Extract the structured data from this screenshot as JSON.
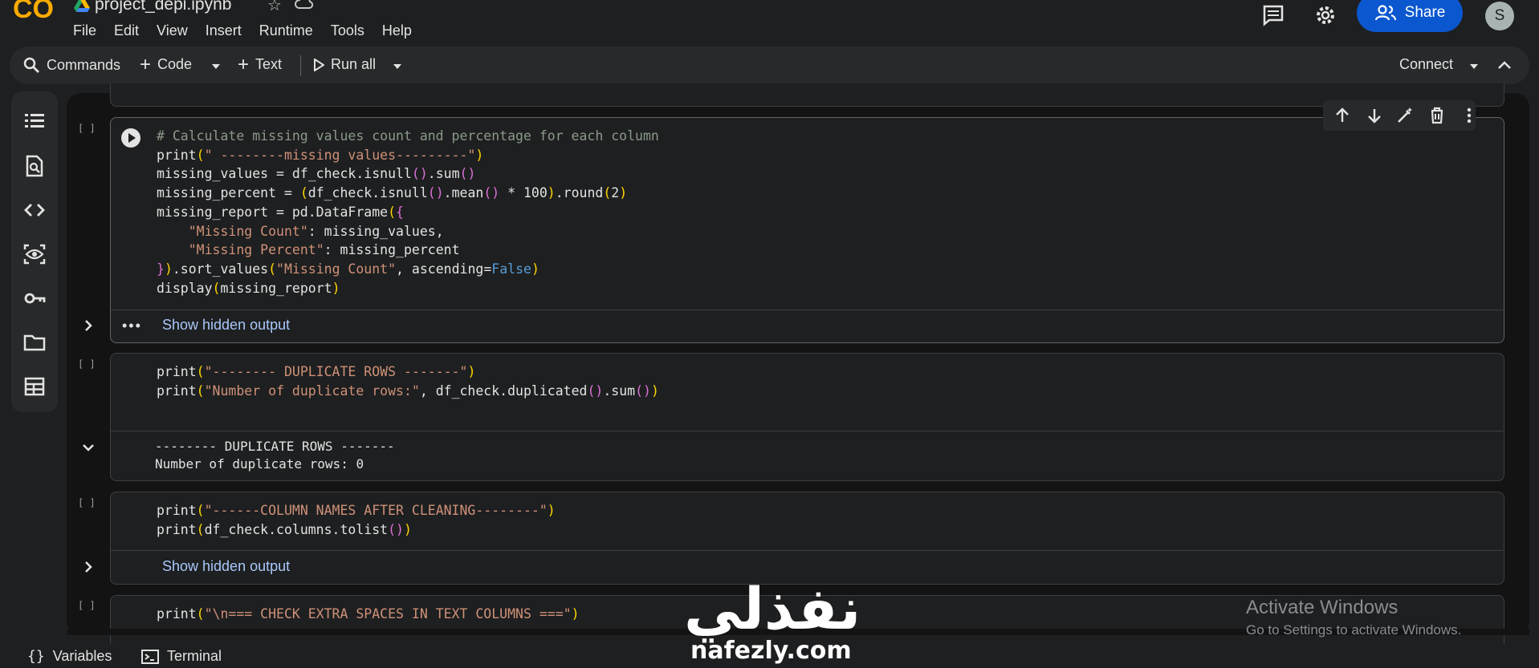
{
  "app": {
    "logo_text": "CO",
    "notebook_title": "project_depi.ipynb",
    "menu": [
      "File",
      "Edit",
      "View",
      "Insert",
      "Runtime",
      "Tools",
      "Help"
    ],
    "share_label": "Share",
    "avatar_letter": "S"
  },
  "toolbar": {
    "commands_label": "Commands",
    "code_label": "Code",
    "text_label": "Text",
    "run_all_label": "Run all",
    "connect_label": "Connect"
  },
  "cells": [
    {
      "exec_count": "[ ]",
      "code_lines": [
        "# Calculate missing values count and percentage for each column",
        "print(\" --------missing values---------\")",
        "missing_values = df_check.isnull().sum()",
        "missing_percent = (df_check.isnull().mean() * 100).round(2)",
        "missing_report = pd.DataFrame({",
        "    \"Missing Count\": missing_values,",
        "    \"Missing Percent\": missing_percent",
        "}).sort_values(\"Missing Count\", ascending=False)",
        "display(missing_report)"
      ],
      "hidden_output_label": "Show hidden output"
    },
    {
      "exec_count": "[ ]",
      "code_lines": [
        "print(\"-------- DUPLICATE ROWS -------\")",
        "print(\"Number of duplicate rows:\", df_check.duplicated().sum())"
      ],
      "output_lines": [
        "-------- DUPLICATE ROWS -------",
        "Number of duplicate rows: 0"
      ]
    },
    {
      "exec_count": "[ ]",
      "code_lines": [
        "print(\"------COLUMN NAMES AFTER CLEANING--------\")",
        "print(df_check.columns.tolist())"
      ],
      "hidden_output_label": "Show hidden output"
    },
    {
      "exec_count": "[ ]",
      "code_lines": [
        "print(\"\\n=== CHECK EXTRA SPACES IN TEXT COLUMNS ===\")"
      ]
    }
  ],
  "bottom_bar": {
    "variables_label": "Variables",
    "terminal_label": "Terminal"
  },
  "overlay": {
    "activate_title": "Activate Windows",
    "activate_sub": "Go to Settings to activate Windows.",
    "watermark_arabic": "نفذلي",
    "watermark_url": "nafezly.com"
  },
  "colors": {
    "accent": "#0b57d0",
    "link": "#a8c7fa",
    "string": "#ce9178",
    "keyword": "#569cd6",
    "comment": "#8a9a8a"
  }
}
